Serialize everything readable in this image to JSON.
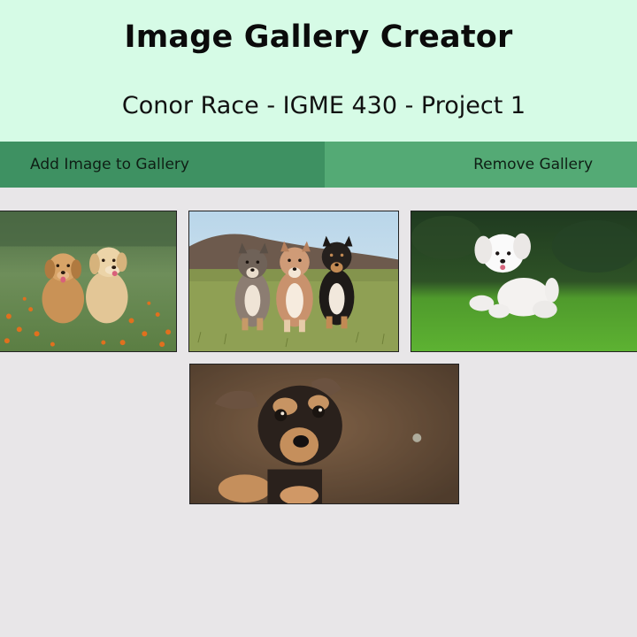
{
  "header": {
    "title": "Image Gallery Creator",
    "subtitle": "Conor Race - IGME 430 - Project 1"
  },
  "nav": {
    "add_label": "Add Image to Gallery",
    "remove_label": "Remove Gallery"
  },
  "colors": {
    "header_bg": "#d6fbe6",
    "nav_add_bg": "#3e9162",
    "nav_remove_bg": "#54aa75",
    "page_bg": "#e8e6e8"
  },
  "gallery": {
    "images": [
      {
        "subject": "two golden retriever puppies in a flower field"
      },
      {
        "subject": "three puppies sitting in grass"
      },
      {
        "subject": "white fluffy puppy running on grass"
      },
      {
        "subject": "black and tan puppy close-up"
      }
    ]
  }
}
